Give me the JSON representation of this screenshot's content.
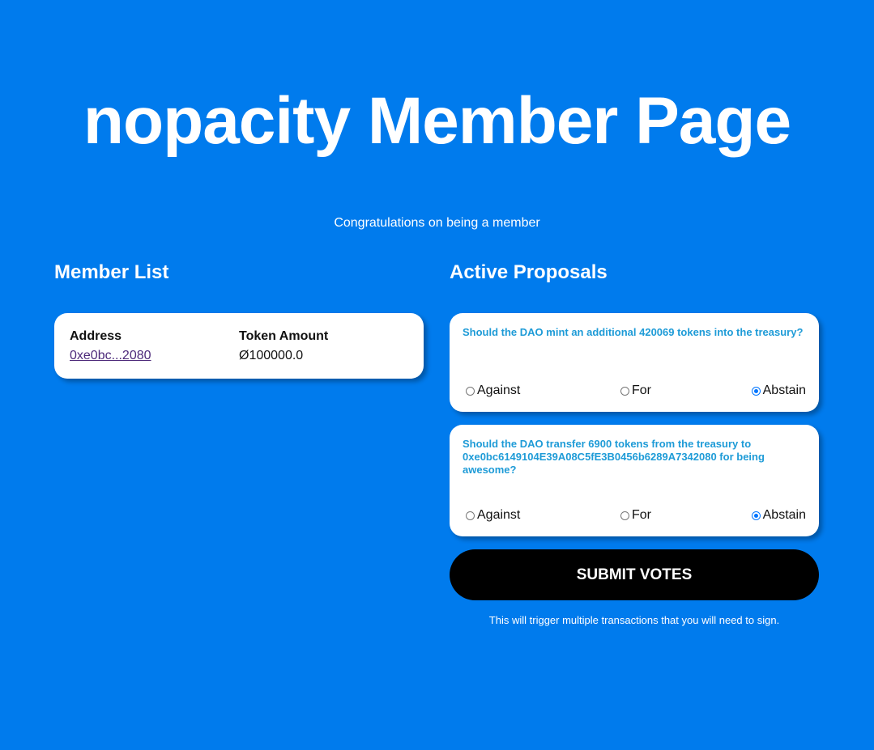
{
  "header": {
    "title": "nopacity Member Page",
    "subtitle": "Congratulations on being a member"
  },
  "members": {
    "heading": "Member List",
    "columns": [
      "Address",
      "Token Amount"
    ],
    "rows": [
      {
        "address": "0xe0bc...2080",
        "token_amount": "Ø100000.0"
      }
    ]
  },
  "proposals": {
    "heading": "Active Proposals",
    "items": [
      {
        "question": "Should the DAO mint an additional 420069 tokens into the treasury?",
        "options": [
          "Against",
          "For",
          "Abstain"
        ],
        "selected": "Abstain"
      },
      {
        "question": "Should the DAO transfer 6900 tokens from the treasury to 0xe0bc6149104E39A08C5fE3B0456b6289A7342080 for being awesome?",
        "options": [
          "Against",
          "For",
          "Abstain"
        ],
        "selected": "Abstain"
      }
    ]
  },
  "actions": {
    "submit_label": "SUBMIT VOTES",
    "hint": "This will trigger multiple transactions that you will need to sign."
  },
  "colors": {
    "background": "#007bed",
    "card": "#ffffff",
    "question_text": "#1e9bd7",
    "button": "#000000",
    "radio_checked": "#0075ff"
  }
}
